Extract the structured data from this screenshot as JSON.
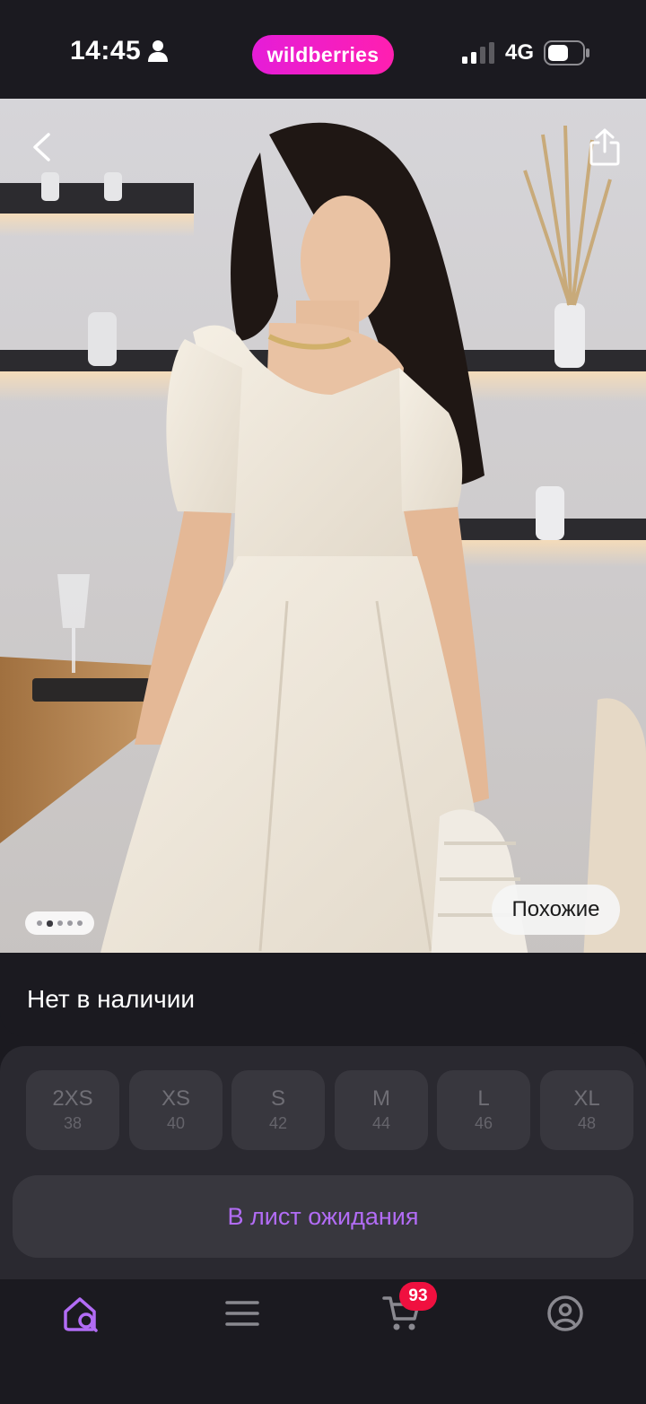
{
  "status_bar": {
    "time": "14:45",
    "brand": "wildberries",
    "network": "4G",
    "brand_color": "#e51dd8"
  },
  "gallery": {
    "pages": 5,
    "active_page": 1,
    "similar_label": "Похожие"
  },
  "product": {
    "stock_status": "Нет в наличии"
  },
  "sizes": [
    {
      "size": "2XS",
      "ru": "38"
    },
    {
      "size": "XS",
      "ru": "40"
    },
    {
      "size": "S",
      "ru": "42"
    },
    {
      "size": "M",
      "ru": "44"
    },
    {
      "size": "L",
      "ru": "46"
    },
    {
      "size": "XL",
      "ru": "48"
    }
  ],
  "actions": {
    "waitlist_label": "В лист ожидания",
    "accent_color": "#b26cf5"
  },
  "nav": {
    "items": [
      "search-home-icon",
      "menu-icon",
      "cart-icon",
      "profile-icon"
    ],
    "cart_count": "93",
    "badge_color": "#f0103f"
  }
}
